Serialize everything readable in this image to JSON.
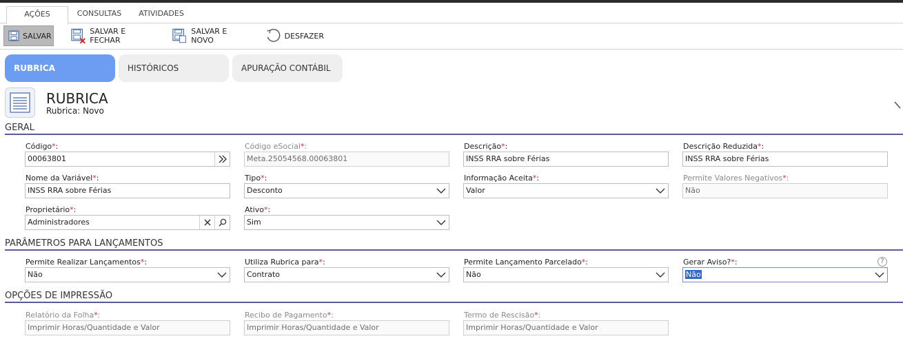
{
  "ribbon_tabs": [
    {
      "label": "AÇÕES",
      "active": true
    },
    {
      "label": "CONSULTAS",
      "active": false
    },
    {
      "label": "ATIVIDADES",
      "active": false
    }
  ],
  "toolbar": {
    "save": "SALVAR",
    "save_close": "SALVAR E FECHAR",
    "save_new": "SALVAR E NOVO",
    "undo": "DESFAZER"
  },
  "page_tabs": [
    {
      "label": "RUBRICA",
      "active": true
    },
    {
      "label": "HISTÓRICOS",
      "active": false
    },
    {
      "label": "APURAÇÃO CONTÁBIL",
      "active": false
    }
  ],
  "header": {
    "title": "RUBRICA",
    "subtitle": "Rubrica: Novo"
  },
  "sections": {
    "geral": "GERAL",
    "parametros": "PARÂMETROS PARA LANÇAMENTOS",
    "impressao": "OPÇÕES DE IMPRESSÃO"
  },
  "fields": {
    "codigo": {
      "label": "Código",
      "value": "00063801"
    },
    "codigo_esocial": {
      "label": "Código eSocial",
      "value": "Meta.25054568.00063801"
    },
    "descricao": {
      "label": "Descrição",
      "value": "INSS RRA sobre Férias"
    },
    "descricao_reduzida": {
      "label": "Descrição Reduzida",
      "value": "INSS RRA sobre Férias"
    },
    "nome_variavel": {
      "label": "Nome da Variável",
      "value": "INSS RRA sobre Férias"
    },
    "tipo": {
      "label": "Tipo",
      "value": "Desconto"
    },
    "informacao_aceita": {
      "label": "Informação Aceita",
      "value": "Valor"
    },
    "permite_negativos": {
      "label": "Permite Valores Negativos",
      "value": "Não"
    },
    "proprietario": {
      "label": "Proprietário",
      "value": "Administradores"
    },
    "ativo": {
      "label": "Ativo",
      "value": "Sim"
    },
    "permite_lancamentos": {
      "label": "Permite Realizar Lançamentos",
      "value": "Não"
    },
    "utiliza_rubrica": {
      "label": "Utiliza Rubrica para",
      "value": "Contrato"
    },
    "permite_parcelado": {
      "label": "Permite Lançamento Parcelado",
      "value": "Não"
    },
    "gerar_aviso": {
      "label": "Gerar Aviso?",
      "value": "Não"
    },
    "relatorio_folha": {
      "label": "Relatório da Folha",
      "value": "Imprimir Horas/Quantidade e Valor"
    },
    "recibo_pagamento": {
      "label": "Recibo de Pagamento",
      "value": "Imprimir Horas/Quantidade e Valor"
    },
    "termo_rescisao": {
      "label": "Termo de Rescisão",
      "value": "Imprimir Horas/Quantidade e Valor"
    }
  },
  "required_mark": "*",
  "label_suffix": ":",
  "help_glyph": "?",
  "colors": {
    "accent_tab": "#6d9cf3",
    "section_rule": "#5a5a9a",
    "required": "#d23030"
  }
}
